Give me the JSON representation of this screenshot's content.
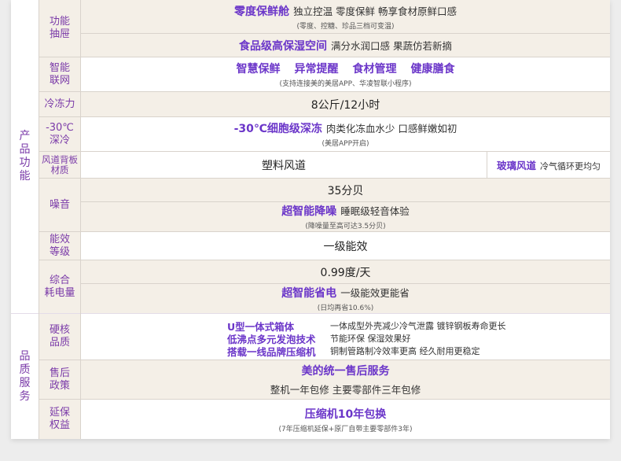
{
  "sections": {
    "product": "产\n品\n功\n能",
    "quality": "品\n质\n服\n务"
  },
  "rows": {
    "drawer": {
      "label": "功能\n抽屉",
      "a_highlight": "零度保鲜舱",
      "a_desc": "独立控温 零度保鲜 畅享食材原鲜口感",
      "a_sub": "(零度、控糖、珍品三档可变温)",
      "b_highlight": "食品级高保湿空间",
      "b_desc": "满分水润口感 果蔬仿若新摘"
    },
    "smart": {
      "label": "智能\n联网",
      "items": [
        "智慧保鲜",
        "异常提醒",
        "食材管理",
        "健康膳食"
      ],
      "sub": "(支持连接美的美居APP、华凌智联小程序)"
    },
    "freeze": {
      "label": "冷冻力",
      "value": "8公斤/12小时"
    },
    "deep": {
      "label": "-30℃\n深冷",
      "highlight": "-30℃细胞级深冻",
      "desc": "肉类化冻血水少 口感鲜嫩如初",
      "sub": "(美居APP开启)"
    },
    "duct": {
      "label": "风道背板\n材质",
      "left": "塑料风道",
      "right_highlight": "玻璃风道",
      "right_desc": "冷气循环更均匀"
    },
    "noise": {
      "label": "噪音",
      "value": "35分贝",
      "highlight": "超智能降噪",
      "desc": "睡眠级轻音体验",
      "sub": "(降噪量至高可达3.5分贝)"
    },
    "efficiency": {
      "label": "能效\n等级",
      "value": "一级能效"
    },
    "power": {
      "label": "综合\n耗电量",
      "value": "0.99度/天",
      "highlight": "超智能省电",
      "desc": "一级能效更能省",
      "sub": "(日均再省10.6%)"
    },
    "core": {
      "label": "硬核\n品质",
      "items": [
        {
          "highlight": "U型一体式箱体",
          "desc": "一体成型外壳减少冷气泄露   镀锌钢板寿命更长"
        },
        {
          "highlight": "低沸点多元发泡技术",
          "desc": "节能环保   保湿效果好"
        },
        {
          "highlight": "搭载一线品牌压缩机",
          "desc": "铜制管路制冷效率更高 经久耐用更稳定"
        }
      ]
    },
    "service": {
      "label": "售后\n政策",
      "highlight": "美的统一售后服务",
      "desc": "整机一年包修   主要零部件三年包修"
    },
    "warranty": {
      "label": "延保\n权益",
      "highlight": "压缩机10年包换",
      "sub": "(7年压缩机延保+原厂自带主要零部件3年)"
    }
  }
}
